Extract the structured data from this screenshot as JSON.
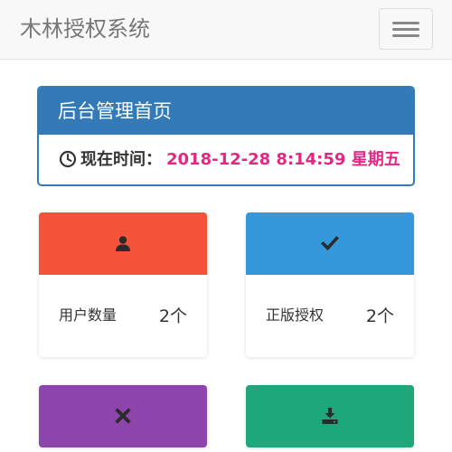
{
  "navbar": {
    "brand": "木林授权系统",
    "menu_icon": "hamburger-menu-icon"
  },
  "panel": {
    "title": "后台管理首页",
    "clock_icon": "clock-icon",
    "time_label": "现在时间：",
    "time_value": "2018-12-28 8:14:59 星期五"
  },
  "cards": [
    {
      "icon": "user-icon",
      "label": "用户数量",
      "count": "2个",
      "color": "#f4533a"
    },
    {
      "icon": "checkmark-icon",
      "label": "正版授权",
      "count": "2个",
      "color": "#3598db"
    },
    {
      "icon": "close-icon",
      "label": "",
      "count": "",
      "color": "#8e44ad"
    },
    {
      "icon": "download-icon",
      "label": "",
      "count": "",
      "color": "#1fa67a"
    }
  ]
}
